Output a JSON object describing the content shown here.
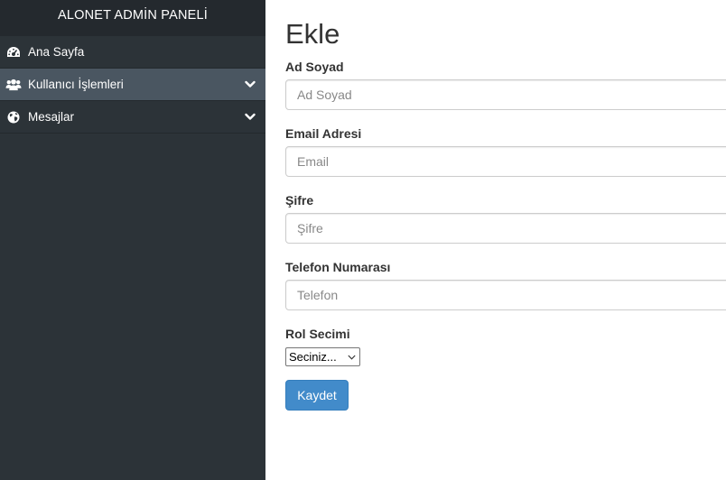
{
  "sidebar": {
    "brand": "ALONET ADMİN PANELİ",
    "items": [
      {
        "label": "Ana Sayfa",
        "icon": "dashboard-icon",
        "has_submenu": false,
        "active": false
      },
      {
        "label": "Kullanıcı İşlemleri",
        "icon": "users-icon",
        "has_submenu": true,
        "active": true
      },
      {
        "label": "Mesajlar",
        "icon": "globe-icon",
        "has_submenu": true,
        "active": false
      }
    ]
  },
  "main": {
    "title": "Ekle",
    "fields": {
      "name": {
        "label": "Ad Soyad",
        "placeholder": "Ad Soyad",
        "value": ""
      },
      "email": {
        "label": "Email Adresi",
        "placeholder": "Email",
        "value": ""
      },
      "password": {
        "label": "Şifre",
        "placeholder": "Şifre",
        "value": ""
      },
      "phone": {
        "label": "Telefon Numarası",
        "placeholder": "Telefon",
        "value": ""
      }
    },
    "role": {
      "label": "Rol Secimi",
      "selected": "Seciniz..."
    },
    "submit_label": "Kaydet"
  },
  "colors": {
    "sidebar_bg": "#2c3338",
    "brand_bg": "#24292e",
    "active_item_bg": "#4a5661",
    "primary_button": "#428bca"
  }
}
